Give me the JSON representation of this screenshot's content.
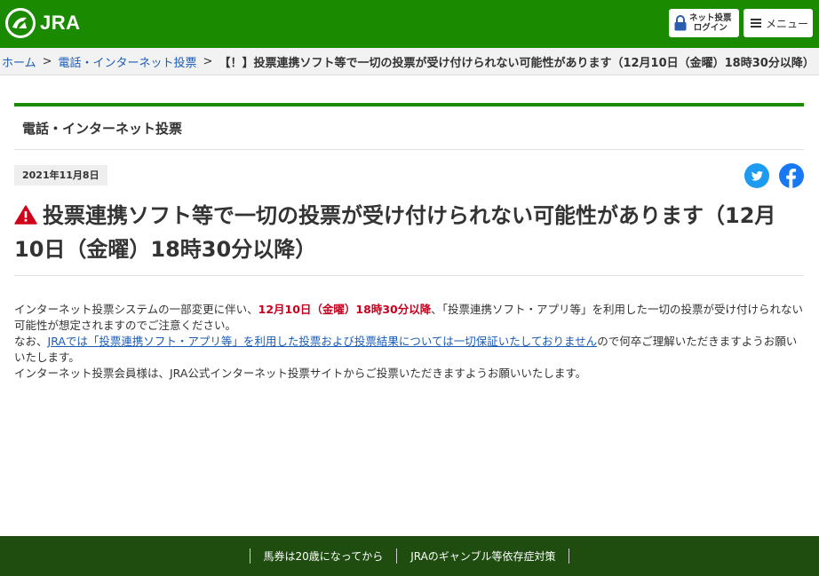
{
  "header": {
    "logo_text": "JRA",
    "login_line1": "ネット投票",
    "login_line2": "ログイン",
    "menu_label": "メニュー",
    "brand_color": "#1a8a00"
  },
  "breadcrumb": {
    "home": "ホーム",
    "section": "電話・インターネット投票",
    "current": "【！】投票連携ソフト等で一切の投票が受け付けられない可能性があります（12月10日（金曜）18時30分以降）",
    "separator": ">"
  },
  "main": {
    "section_title": "電話・インターネット投票",
    "date": "2021年11月8日",
    "headline": "投票連携ソフト等で一切の投票が受け付けられない可能性があります（12月10日（金曜）18時30分以降）",
    "p1_a": "インターネット投票システムの一部変更に伴い、",
    "p1_red": "12月10日（金曜）18時30分以降",
    "p1_b": "、「投票連携ソフト・アプリ等」を利用した一切の投票が受け付けられない可能性が想定されますのでご注意ください。",
    "p2_a": "なお、",
    "p2_link": "JRAでは「投票連携ソフト・アプリ等」を利用した投票および投票結果については一切保証いたしておりません",
    "p2_b": "ので何卒ご理解いただきますようお願いいたします。",
    "p3": "インターネット投票会員様は、JRA公式インターネット投票サイトからご投票いただきますようお願いいたします。",
    "accent_red": "#c8001e"
  },
  "social": {
    "twitter_icon": "twitter-icon",
    "facebook_icon": "facebook-icon"
  },
  "footer": {
    "link1": "馬券は20歳になってから",
    "link2": "JRAのギャンブル等依存症対策",
    "bg_color": "#1e4d0f"
  }
}
